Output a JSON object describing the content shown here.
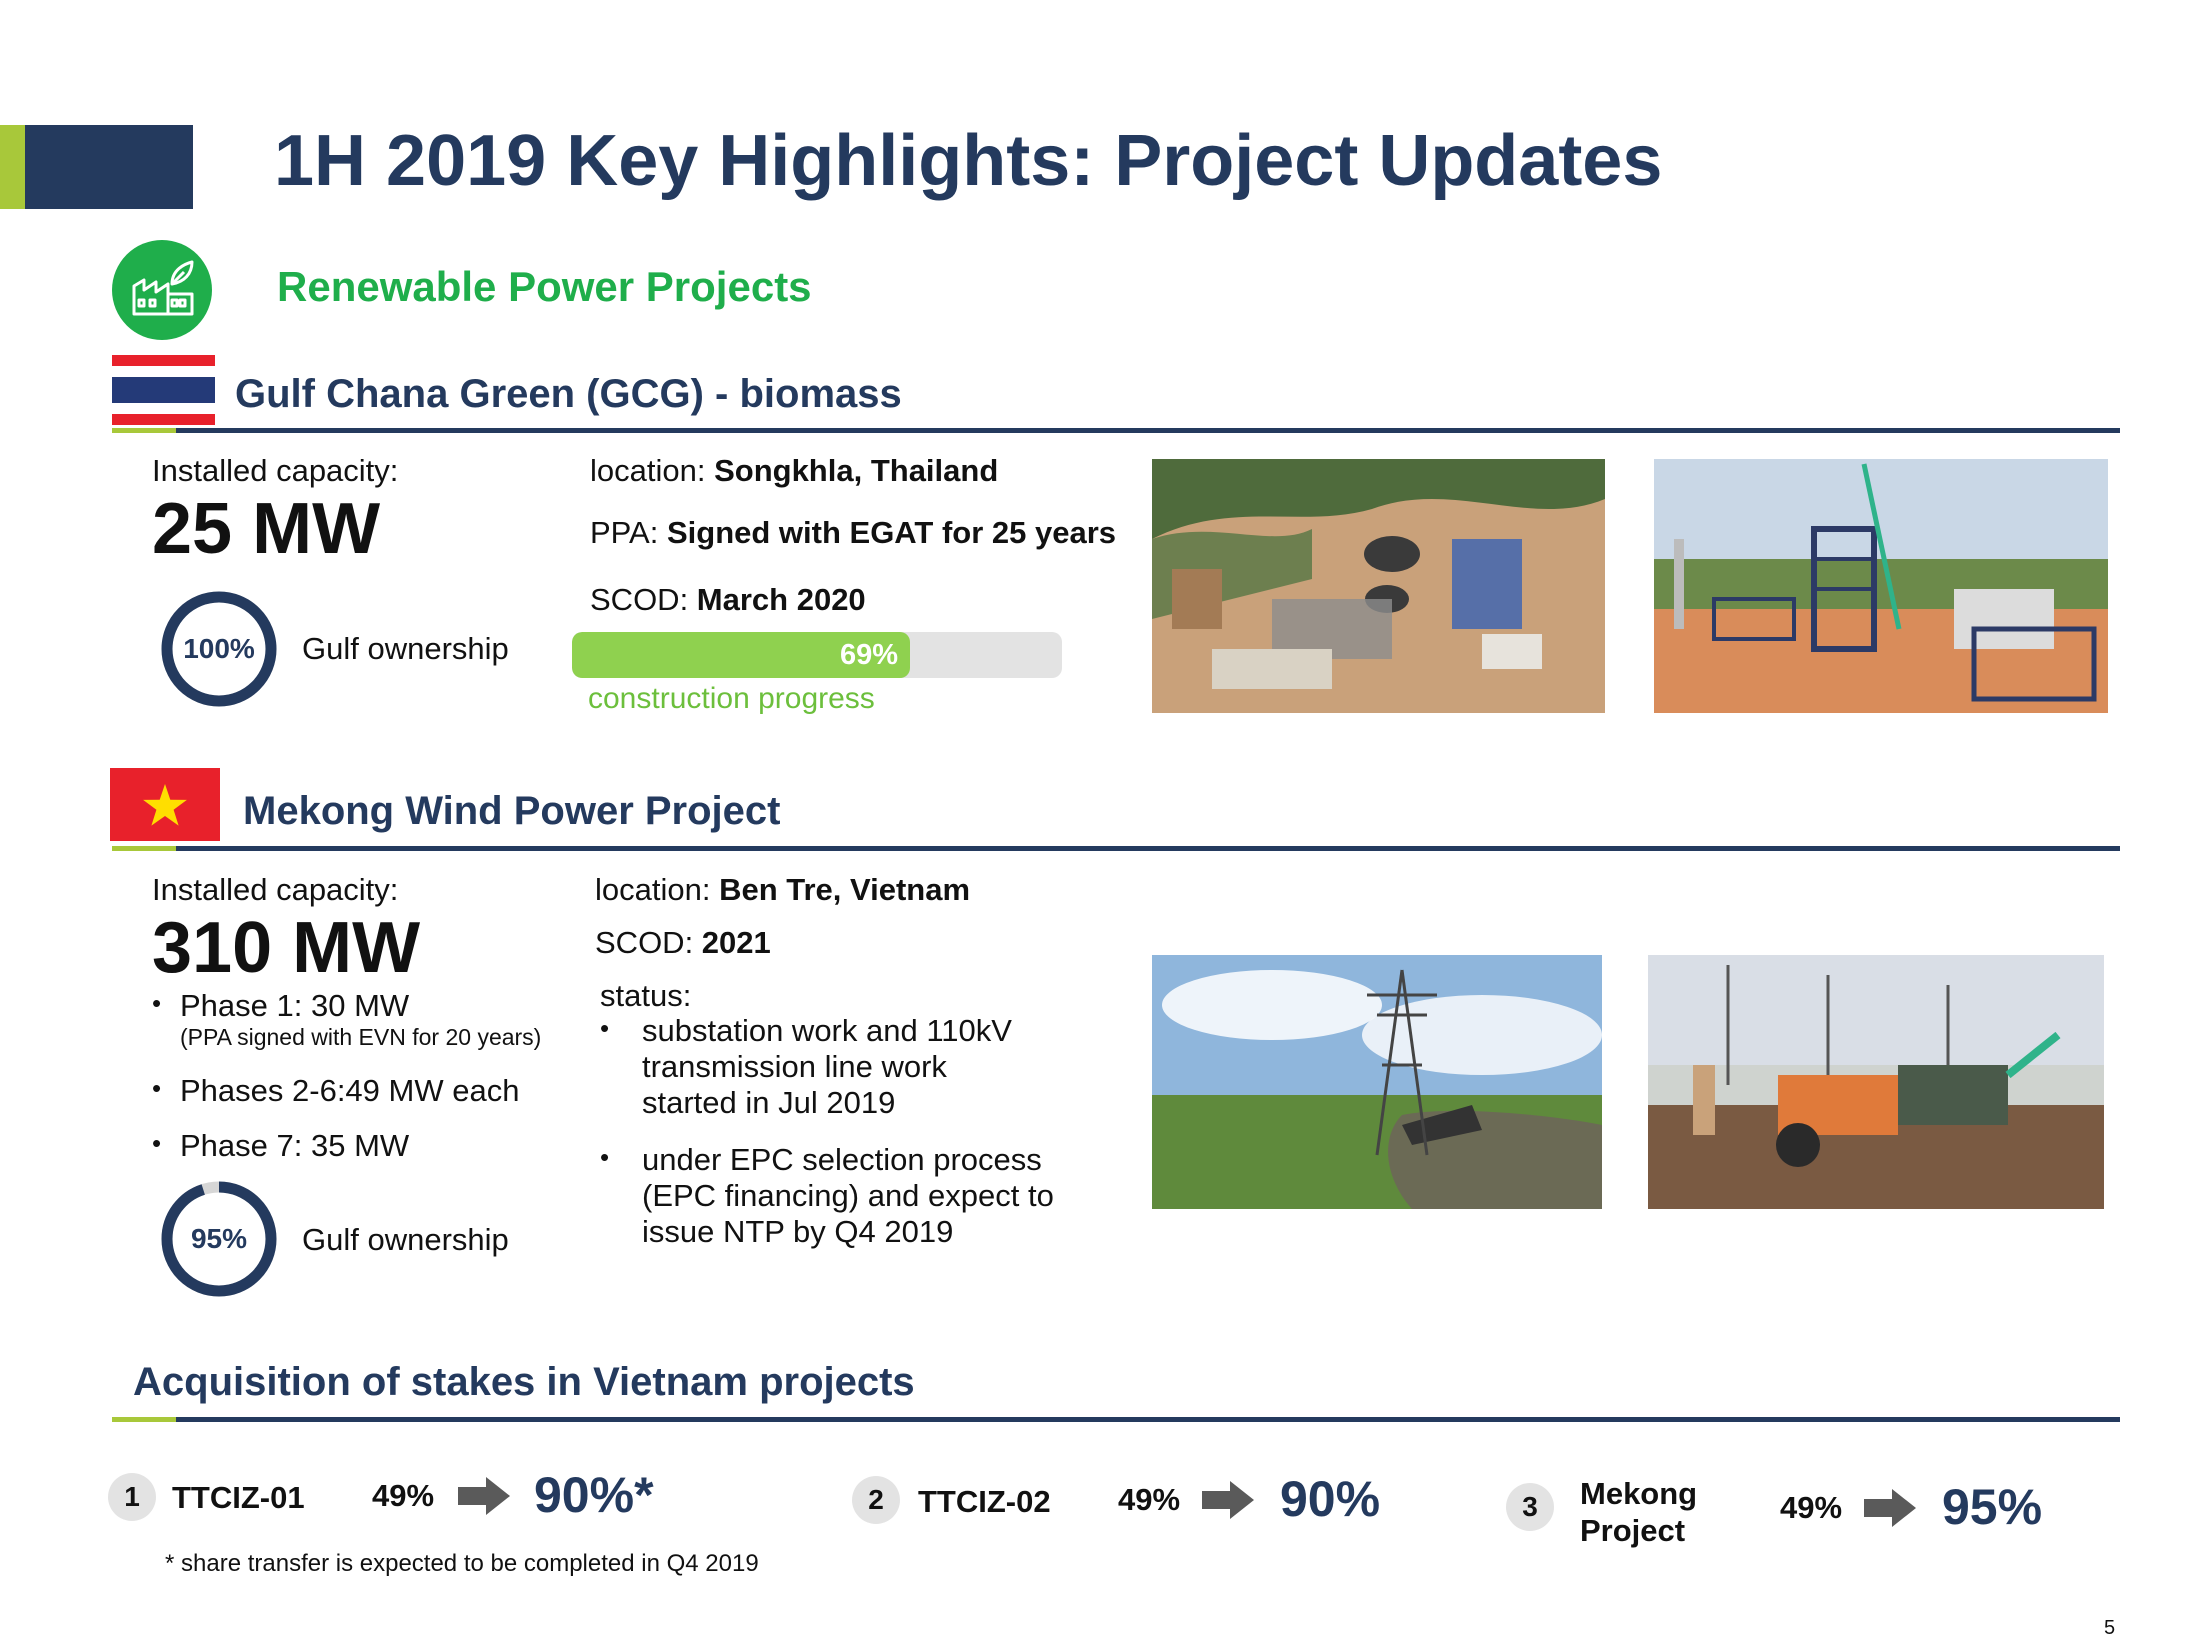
{
  "header": {
    "title": "1H 2019 Key Highlights: Project Updates"
  },
  "section": {
    "title": "Renewable Power Projects",
    "icon": "factory-leaf-icon"
  },
  "gcg": {
    "title": "Gulf Chana Green (GCG) - biomass",
    "capacity_label": "Installed capacity:",
    "capacity_value": "25 MW",
    "ownership_pct": "100%",
    "ownership_fraction": 1.0,
    "ownership_label": "Gulf ownership",
    "location_label": "location: ",
    "location_value": "Songkhla, Thailand",
    "ppa_label": "PPA: ",
    "ppa_value": "Signed with EGAT for 25 years",
    "scod_label": "SCOD: ",
    "scod_value": "March 2020",
    "progress_pct": "69%",
    "progress_fraction": 0.69,
    "progress_label": "construction progress"
  },
  "mekong": {
    "title": "Mekong Wind Power Project",
    "capacity_label": "Installed capacity:",
    "capacity_value": "310 MW",
    "phases": [
      {
        "text": "Phase 1: 30 MW",
        "note": "(PPA signed with EVN for 20 years)"
      },
      {
        "text": "Phases 2-6:49 MW each",
        "note": ""
      },
      {
        "text": "Phase 7: 35 MW",
        "note": ""
      }
    ],
    "ownership_pct": "95%",
    "ownership_fraction": 0.95,
    "ownership_label": "Gulf ownership",
    "location_label": "location: ",
    "location_value": "Ben Tre, Vietnam",
    "scod_label": "SCOD: ",
    "scod_value": "2021",
    "status_label": "status:",
    "status_items": [
      "substation work and 110kV transmission line work started in Jul 2019",
      "under EPC selection process (EPC financing) and expect to issue NTP by Q4 2019"
    ]
  },
  "acquisition": {
    "title": "Acquisition of stakes in Vietnam projects",
    "items": [
      {
        "num": "1",
        "name": "TTCIZ-01",
        "from": "49%",
        "to": "90%*"
      },
      {
        "num": "2",
        "name": "TTCIZ-02",
        "from": "49%",
        "to": "90%"
      },
      {
        "num": "3",
        "name": "Mekong Project",
        "from": "49%",
        "to": "95%"
      }
    ],
    "footnote": "* share transfer is expected to be completed in Q4 2019"
  },
  "page_number": "5",
  "colors": {
    "navy": "#243a5e",
    "accent_green": "#a8c83a",
    "bright_green": "#1fae4b",
    "progress_green": "#8fd14f",
    "progress_text": "#6cbf3c"
  }
}
